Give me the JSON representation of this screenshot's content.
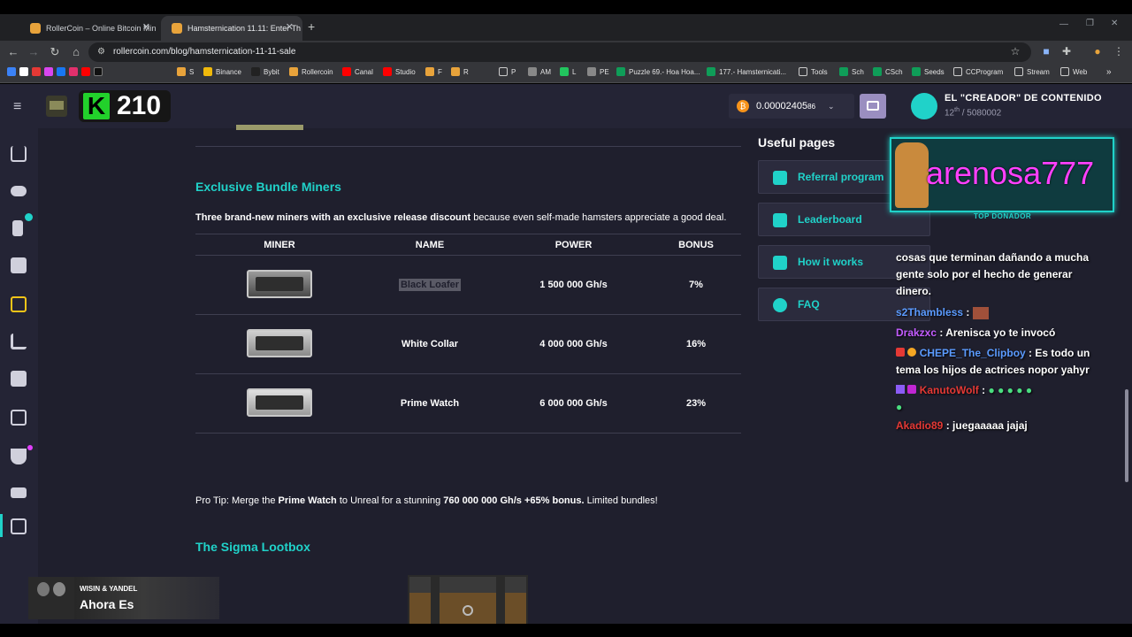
{
  "browser": {
    "tabs": [
      {
        "title": "RollerCoin – Online Bitcoin Min",
        "active": false
      },
      {
        "title": "Hamsternication 11.11: Enter Th",
        "active": true
      }
    ],
    "url": "rollercoin.com/blog/hamsternication-11-11-sale",
    "new_tab": "+",
    "bookmarks": [
      "S",
      "Binance",
      "Bybit",
      "Rollercoin",
      "Canal",
      "Studio",
      "F",
      "R",
      "P",
      "AM",
      "L",
      "PE",
      "Puzzle 69.- Hoa Hoa...",
      "177.- Hamsternicati...",
      "Tools",
      "Sch",
      "CSch",
      "Seeds",
      "CCProgram",
      "Stream",
      "Web"
    ]
  },
  "header": {
    "level": "210",
    "balance": "0.00002405",
    "balance_small": "86",
    "username": "EL \"CREADOR\" DE CONTENIDO",
    "rank": "12",
    "rank_suffix": "th",
    "rank_total": "/ 5080002"
  },
  "article": {
    "section1_title": "Exclusive Bundle Miners",
    "intro_bold": "Three brand-new miners with an exclusive release discount",
    "intro_rest": " because even self-made hamsters appreciate a good deal.",
    "table": {
      "headers": [
        "MINER",
        "NAME",
        "POWER",
        "BONUS"
      ],
      "rows": [
        {
          "name": "Black Loafer",
          "power": "1 500 000 Gh/s",
          "bonus": "7%"
        },
        {
          "name": "White Collar",
          "power": "4 000 000 Gh/s",
          "bonus": "16%"
        },
        {
          "name": "Prime Watch",
          "power": "6 000 000 Gh/s",
          "bonus": "23%"
        }
      ]
    },
    "tip_prefix": "Pro Tip: Merge the ",
    "tip_bold1": "Prime Watch",
    "tip_mid": " to Unreal for a stunning ",
    "tip_bold2": "760 000 000 Gh/s +65% bonus.",
    "tip_suffix": " Limited bundles!",
    "section2_title": "The Sigma Lootbox"
  },
  "useful_pages": {
    "title": "Useful pages",
    "items": [
      "Referral program",
      "Leaderboard",
      "How it works",
      "FAQ"
    ]
  },
  "overlay": {
    "donor_name": "arenosa777",
    "donor_label": "TOP DONADOR",
    "now_playing_artist": "WISIN & YANDEL",
    "now_playing_song": "Ahora Es"
  },
  "chat": [
    {
      "user": "",
      "text": "cosas que terminan dañando a mucha"
    },
    {
      "user": "",
      "text": "gente solo por el hecho de generar"
    },
    {
      "user": "",
      "text": "dinero."
    },
    {
      "user": "s2Thambless",
      "text": " :"
    },
    {
      "user": "Drakzxc",
      "text": " : Arenisca yo te invocó"
    },
    {
      "user": "CHEPE_The_Clipboy",
      "text": " : Es todo un"
    },
    {
      "user": "",
      "text": "tema los hijos de actrices nopor yahyr"
    },
    {
      "user": "KanutoWolf",
      "text": " :"
    },
    {
      "user": "Akadio89",
      "text": " : juegaaaaa jajaj"
    }
  ],
  "colors": {
    "accent": "#20d2c9",
    "background": "#1f1f2d",
    "panel": "#242435",
    "donor_magenta": "#ff40ff"
  }
}
